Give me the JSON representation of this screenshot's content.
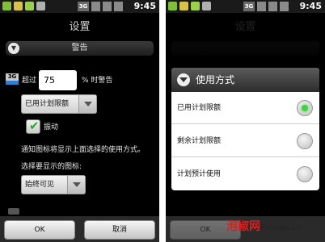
{
  "status_bar": {
    "network": "3G",
    "time": "9:45"
  },
  "settings": {
    "title": "设置",
    "section_label": "警告",
    "exceed_prefix": "超过",
    "threshold_value": "75",
    "threshold_suffix": "% 时警告",
    "usage_mode_selected": "已用计划限额",
    "vibrate_label": "振动",
    "vibrate_checked": true,
    "notify_text": "通知图标将显示上面选择的使用方式。",
    "icon_prompt": "选择要显示的图标:",
    "icon_mode_selected": "始终可见"
  },
  "buttons": {
    "ok": "OK",
    "cancel": "取消"
  },
  "dialog": {
    "title": "使用方式",
    "options": [
      {
        "label": "已用计划限额",
        "selected": true
      },
      {
        "label": "剩余计划限额",
        "selected": false
      },
      {
        "label": "计划预计使用",
        "selected": false
      }
    ]
  },
  "watermark": {
    "brand": "泡椒网",
    "domain": "Paojiao.cn"
  },
  "colors": {
    "accent_green": "#3fd33f",
    "background": "#000000"
  }
}
